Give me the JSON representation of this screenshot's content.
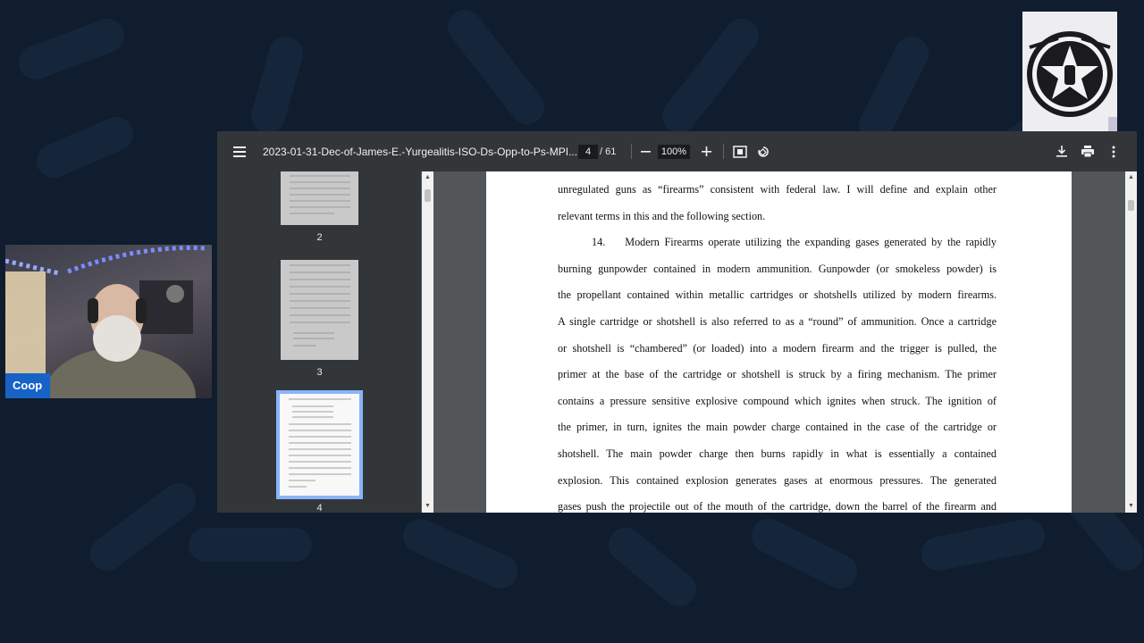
{
  "participant": {
    "name": "Coop"
  },
  "viewer": {
    "title": "2023-01-31-Dec-of-James-E.-Yurgealitis-ISO-Ds-Opp-to-Ps-MPI....",
    "current_page": "4",
    "page_total": "/ 61",
    "zoom": "100%",
    "icons": {
      "menu": "menu-icon",
      "zoom_out": "minus-icon",
      "zoom_in": "plus-icon",
      "fit": "fit-page-icon",
      "rotate": "rotate-icon",
      "download": "download-icon",
      "print": "print-icon",
      "more": "more-vert-icon"
    },
    "thumbnails": [
      {
        "label": "2"
      },
      {
        "label": "3"
      },
      {
        "label": "4"
      }
    ]
  },
  "document": {
    "lines": [
      "unregulated guns as “firearms” consistent with federal law.  I will define and explain other",
      "relevant terms in this and the following section.",
      "14.",
      "Modern Firearms operate utilizing the expanding gases generated by the rapidly",
      "burning gunpowder contained in modern ammunition.  Gunpowder (or smokeless powder) is",
      "the propellant contained within metallic cartridges or shotshells utilized by modern firearms.",
      "A single cartridge or shotshell is also referred to as a “round” of ammunition.  Once a cartridge",
      "or shotshell is “chambered” (or loaded) into a modern firearm and the trigger is pulled, the",
      "primer at the base of the cartridge or shotshell is struck by a firing mechanism.  The primer",
      "contains a pressure sensitive explosive compound which ignites when struck.  The ignition of",
      "the primer, in turn, ignites the main powder charge contained in the case of the cartridge or",
      "shotshell.  The main powder charge then burns rapidly in what is essentially a contained",
      "explosion.  This contained explosion generates gases at enormous pressures.  The generated",
      "gases push the projectile out of the mouth of the cartridge, down the barrel of the firearm and"
    ]
  },
  "colors": {
    "background": "#0f1d2e",
    "toolbar": "#323639",
    "viewer_bg": "#525659",
    "name_badge": "#1762c6",
    "selection": "#8ab4f8"
  }
}
